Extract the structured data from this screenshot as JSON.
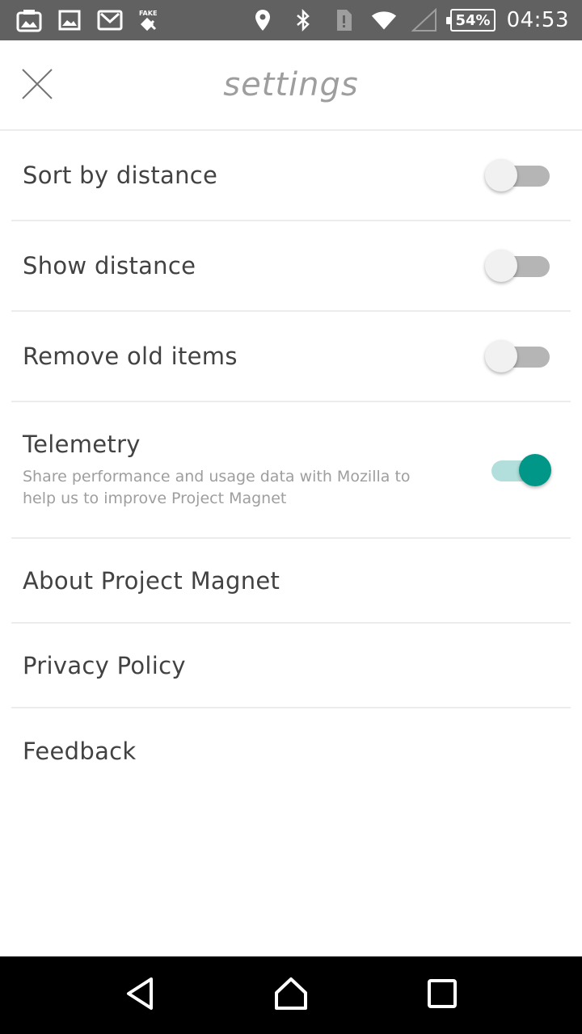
{
  "status_bar": {
    "left_icons": [
      "photo-notification-icon",
      "image-icon",
      "gmail-icon",
      "fake-gps-icon"
    ],
    "right_icons": [
      "location-icon",
      "bluetooth-icon",
      "sim-alert-icon",
      "wifi-icon",
      "signal-icon"
    ],
    "battery": "54%",
    "time": "04:53"
  },
  "header": {
    "title": "settings",
    "close_icon": "close-icon"
  },
  "settings": {
    "sort_by_distance": {
      "label": "Sort by distance",
      "enabled": false
    },
    "show_distance": {
      "label": "Show distance",
      "enabled": false
    },
    "remove_old_items": {
      "label": "Remove old items",
      "enabled": false
    },
    "telemetry": {
      "label": "Telemetry",
      "description": "Share performance and usage data with Mozilla to help us to improve Project Magnet",
      "enabled": true
    }
  },
  "links": {
    "about": "About Project Magnet",
    "privacy": "Privacy Policy",
    "feedback": "Feedback"
  },
  "nav_bar": {
    "back_icon": "back-triangle-icon",
    "home_icon": "home-icon",
    "recents_icon": "recents-square-icon"
  },
  "colors": {
    "status_bar_bg": "#616161",
    "accent": "#009688",
    "accent_track": "#b2dfdb",
    "switch_off_track": "#b5b5b5",
    "divider": "#ececec",
    "title_gray": "#9e9e9e"
  }
}
